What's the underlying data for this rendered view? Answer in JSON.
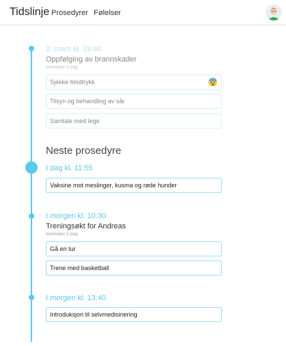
{
  "header": {
    "title": "Tidslinje",
    "nav": [
      "Prosedyrer",
      "Følelser"
    ]
  },
  "past": {
    "time": "2. mars kl. 19:40",
    "title": "Oppfølging av brannskader",
    "subtitle": "Inneholder 3 steg",
    "steps": [
      "Sjekke blodtrykk",
      "Tilsyn og behandling av sår",
      "Samtale med lege"
    ]
  },
  "next": {
    "heading": "Neste prosedyre",
    "time": "I dag kl. 11:55",
    "steps": [
      "Vaksine mot meslinger, kusma og røde hunder"
    ]
  },
  "tomorrow1": {
    "time": "I morgen kl. 10:30",
    "title": "Treningsøkt for Andreas",
    "subtitle": "Inneholder 2 steg",
    "steps": [
      "Gå en tur",
      "Trene med basketball"
    ]
  },
  "tomorrow2": {
    "time": "I morgen kl. 13:40",
    "steps": [
      "Introduksjon til selvmedisinering"
    ]
  },
  "icons": {
    "avatar": "user-avatar",
    "emoji": "anxious-face-icon"
  },
  "colors": {
    "accent": "#5bc8f0",
    "accent_faded": "#b3e3f5"
  }
}
